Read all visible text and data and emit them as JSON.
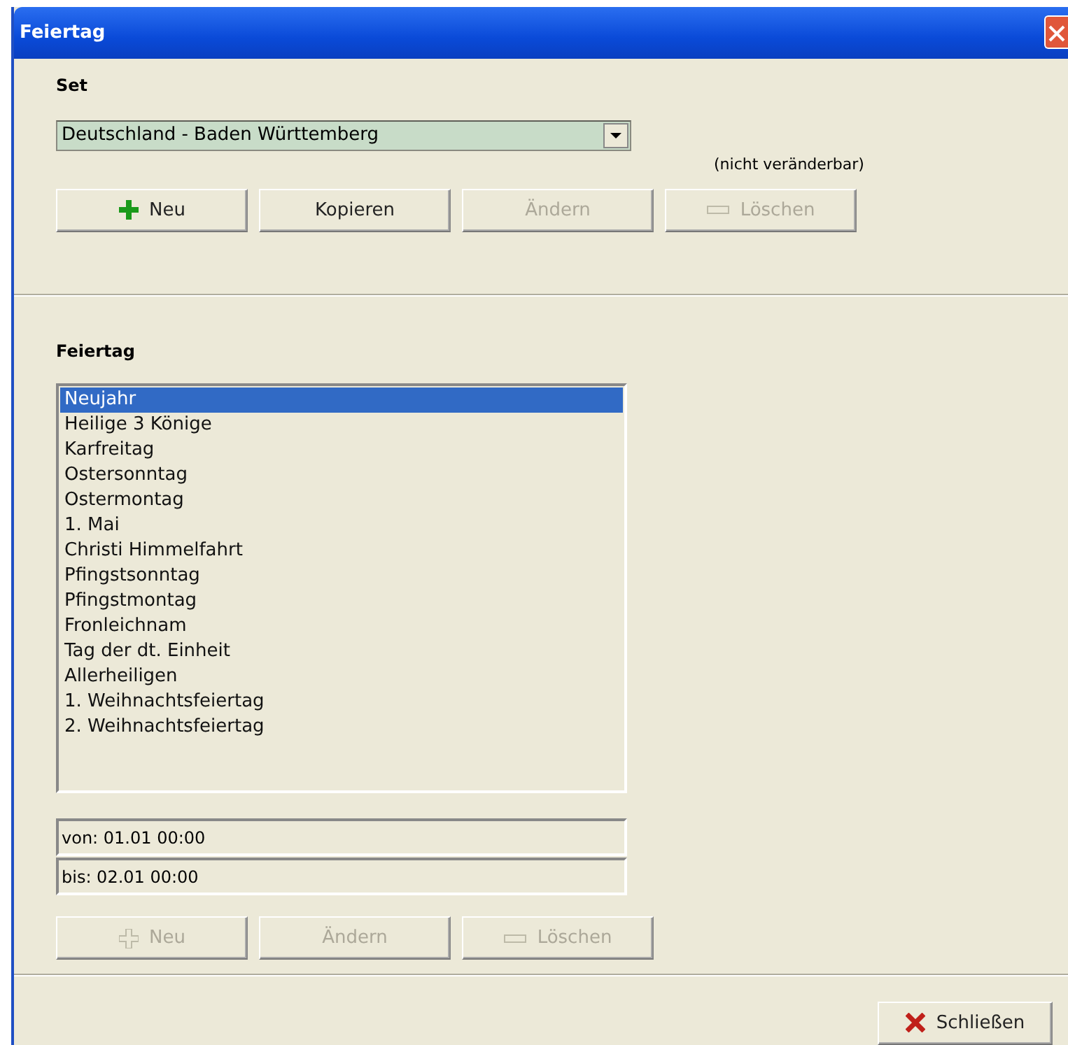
{
  "window": {
    "title": "Feiertag"
  },
  "set_section": {
    "label": "Set",
    "dropdown": {
      "value": "Deutschland - Baden Württemberg"
    },
    "note": "(nicht veränderbar)",
    "buttons": [
      {
        "label": "Neu",
        "kind": "plus",
        "disabled": false
      },
      {
        "label": "Kopieren",
        "kind": "plain",
        "disabled": false
      },
      {
        "label": "Ändern",
        "kind": "plain",
        "disabled": true
      },
      {
        "label": "Löschen",
        "kind": "minus",
        "disabled": true
      }
    ]
  },
  "holiday_section": {
    "label": "Feiertag",
    "items": [
      {
        "label": "Neujahr",
        "selected": true
      },
      {
        "label": "Heilige 3 Könige",
        "selected": false
      },
      {
        "label": "Karfreitag",
        "selected": false
      },
      {
        "label": "Ostersonntag",
        "selected": false
      },
      {
        "label": "Ostermontag",
        "selected": false
      },
      {
        "label": "1. Mai",
        "selected": false
      },
      {
        "label": "Christi Himmelfahrt",
        "selected": false
      },
      {
        "label": "Pfingstsonntag",
        "selected": false
      },
      {
        "label": "Pfingstmontag",
        "selected": false
      },
      {
        "label": "Fronleichnam",
        "selected": false
      },
      {
        "label": "Tag der dt. Einheit",
        "selected": false
      },
      {
        "label": "Allerheiligen",
        "selected": false
      },
      {
        "label": "1. Weihnachtsfeiertag",
        "selected": false
      },
      {
        "label": "2. Weihnachtsfeiertag",
        "selected": false
      }
    ],
    "from": "von:  01.01  00:00",
    "to": "bis:  02.01  00:00",
    "buttons": [
      {
        "label": "Neu",
        "kind": "plus",
        "disabled": true
      },
      {
        "label": "Ändern",
        "kind": "plain",
        "disabled": true
      },
      {
        "label": "Löschen",
        "kind": "minus",
        "disabled": true
      }
    ]
  },
  "footer": {
    "buttons": [
      {
        "label": "Schließen",
        "kind": "close",
        "disabled": false
      }
    ]
  }
}
